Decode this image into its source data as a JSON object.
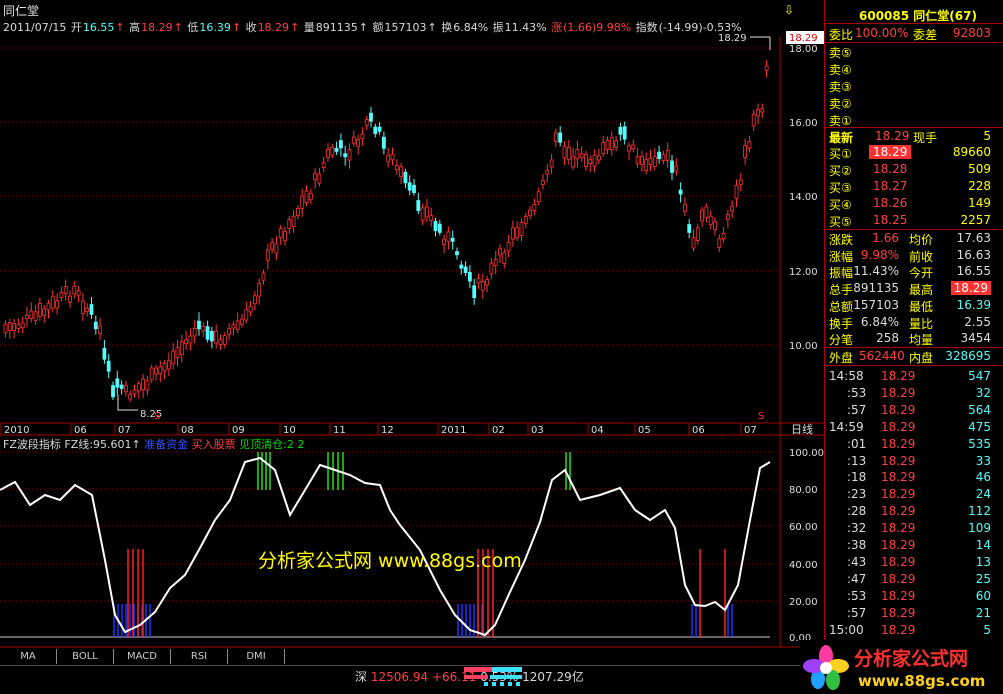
{
  "stock": {
    "name": "同仁堂",
    "code_title": "600085 同仁堂(67)"
  },
  "info_bar": {
    "date": "2011/07/15",
    "open_label": "开",
    "open": "16.55",
    "high_label": "高",
    "high": "18.29",
    "low_label": "低",
    "low": "16.39",
    "close_label": "收",
    "close": "18.29",
    "volume_label": "量",
    "volume": "891135",
    "amount_label": "额",
    "amount": "157103",
    "turnover_label": "换",
    "turnover": "6.84%",
    "amplitude_label": "振",
    "amplitude": "11.43%",
    "change_label": "涨",
    "change": "(1.66)9.98%",
    "index_label": "指数",
    "index": "(-14.99)-0.53%"
  },
  "price_chart": {
    "high_marker": "18.29",
    "low_marker": "8.25",
    "current_tag": "18.29",
    "y_ticks": [
      "18.00",
      "16.00",
      "14.00",
      "12.00",
      "10.00"
    ],
    "x_ticks": [
      "2010",
      "06",
      "07",
      "08",
      "09",
      "10",
      "11",
      "12",
      "2011",
      "02",
      "03",
      "04",
      "05",
      "06",
      "07"
    ],
    "period": "日线",
    "colors": {
      "up": "#ff3232",
      "down": "#54fcfc"
    }
  },
  "indicator": {
    "name": "FZ波段指标",
    "line_label": "FZ线:",
    "line_value": "95.601",
    "legend_blue": "准备资金",
    "legend_red": "买入股票",
    "legend_green": "见顶清仓:",
    "legend_green_value": "2 2",
    "y_ticks": [
      "100.00",
      "80.00",
      "60.00",
      "40.00",
      "20.00",
      "0.00"
    ]
  },
  "watermark": "分析家公式网 www.88gs.com",
  "tabs": [
    "MA",
    "BOLL",
    "MACD",
    "RSI",
    "DMI"
  ],
  "status": {
    "market": "深",
    "index_value": "12506.94",
    "index_change": "+66.11",
    "index_pct": "0.53%",
    "turnover": "1207.29亿"
  },
  "right_panel": {
    "weibi_label": "委比",
    "weibi": "100.00%",
    "weicha_label": "委差",
    "weicha": "92803",
    "sell_levels": [
      "卖⑤",
      "卖④",
      "卖③",
      "卖②",
      "卖①"
    ],
    "latest_label": "最新",
    "latest": "18.29",
    "xianshou_label": "现手",
    "xianshou": "5",
    "buy_levels": [
      {
        "label": "买①",
        "price": "18.29",
        "vol": "89660"
      },
      {
        "label": "买②",
        "price": "18.28",
        "vol": "509"
      },
      {
        "label": "买③",
        "price": "18.27",
        "vol": "228"
      },
      {
        "label": "买④",
        "price": "18.26",
        "vol": "149"
      },
      {
        "label": "买⑤",
        "price": "18.25",
        "vol": "2257"
      }
    ],
    "stats": [
      {
        "l1": "涨跌",
        "v1": "1.66",
        "l2": "均价",
        "v2": "17.63"
      },
      {
        "l1": "涨幅",
        "v1": "9.98%",
        "l2": "前收",
        "v2": "16.63"
      },
      {
        "l1": "振幅",
        "v1": "11.43%",
        "l2": "今开",
        "v2": "16.55"
      },
      {
        "l1": "总手",
        "v1": "891135",
        "l2": "最高",
        "v2": "18.29"
      },
      {
        "l1": "总额",
        "v1": "157103",
        "l2": "最低",
        "v2": "16.39"
      },
      {
        "l1": "换手",
        "v1": "6.84%",
        "l2": "量比",
        "v2": "2.55"
      },
      {
        "l1": "分笔",
        "v1": "258",
        "l2": "均量",
        "v2": "3454"
      }
    ],
    "waipan_label": "外盘",
    "waipan": "562440",
    "neipan_label": "内盘",
    "neipan": "328695",
    "ticks": [
      {
        "t": "14:58",
        "p": "18.29",
        "v": "547"
      },
      {
        "t": ":53",
        "p": "18.29",
        "v": "32"
      },
      {
        "t": ":57",
        "p": "18.29",
        "v": "564"
      },
      {
        "t": "14:59",
        "p": "18.29",
        "v": "475"
      },
      {
        "t": ":01",
        "p": "18.29",
        "v": "535"
      },
      {
        "t": ":13",
        "p": "18.29",
        "v": "33"
      },
      {
        "t": ":18",
        "p": "18.29",
        "v": "46"
      },
      {
        "t": ":23",
        "p": "18.29",
        "v": "24"
      },
      {
        "t": ":28",
        "p": "18.29",
        "v": "112"
      },
      {
        "t": ":32",
        "p": "18.29",
        "v": "109"
      },
      {
        "t": ":38",
        "p": "18.29",
        "v": "14"
      },
      {
        "t": ":43",
        "p": "18.29",
        "v": "13"
      },
      {
        "t": ":47",
        "p": "18.29",
        "v": "25"
      },
      {
        "t": ":53",
        "p": "18.29",
        "v": "60"
      },
      {
        "t": ":57",
        "p": "18.29",
        "v": "21"
      },
      {
        "t": "15:00",
        "p": "18.29",
        "v": "5"
      }
    ]
  },
  "logo": {
    "name": "分析家公式网",
    "url": "www.88gs.com"
  }
}
